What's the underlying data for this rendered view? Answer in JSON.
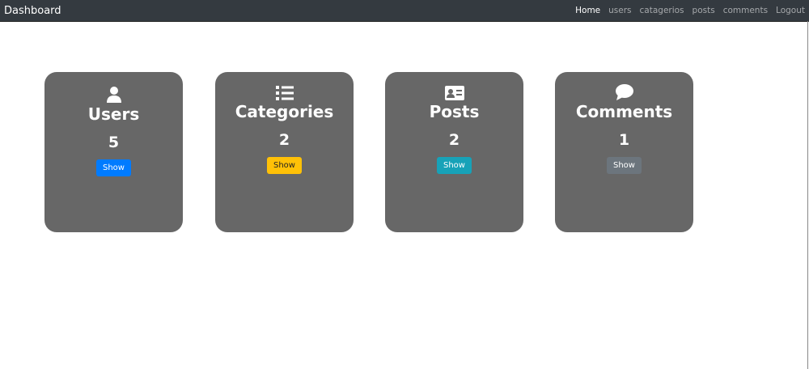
{
  "nav": {
    "brand": "Dashboard",
    "links": [
      "Home",
      "users",
      "catagerios",
      "posts",
      "comments",
      "Logout"
    ]
  },
  "cards": [
    {
      "title": "Users",
      "count": "5",
      "button": "Show",
      "icon": "user-icon",
      "color": "#007bff"
    },
    {
      "title": "Categories",
      "count": "2",
      "button": "Show",
      "icon": "list-icon",
      "color": "#ffc107"
    },
    {
      "title": "Posts",
      "count": "2",
      "button": "Show",
      "icon": "id-card-icon",
      "color": "#17a2b8"
    },
    {
      "title": "Comments",
      "count": "1",
      "button": "Show",
      "icon": "comment-icon",
      "color": "#6c757d"
    }
  ]
}
